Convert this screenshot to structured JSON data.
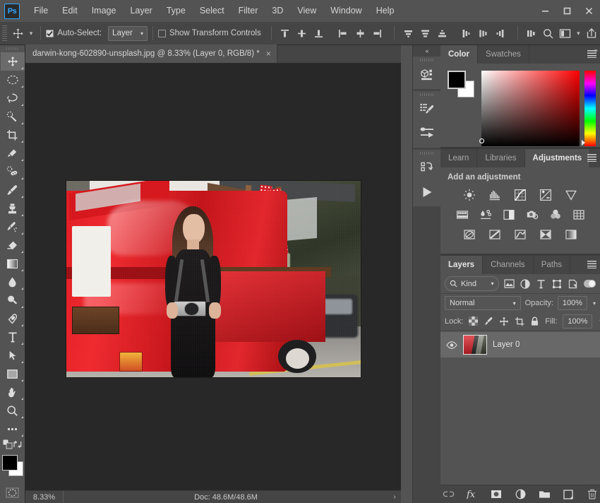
{
  "app": {
    "logo_text": "Ps",
    "menus": [
      "File",
      "Edit",
      "Image",
      "Layer",
      "Type",
      "Select",
      "Filter",
      "3D",
      "View",
      "Window",
      "Help"
    ],
    "window_controls": [
      "minimize-button",
      "maximize-button",
      "close-button"
    ]
  },
  "options_bar": {
    "active_tool_icon": "move-tool-icon",
    "auto_select_label": "Auto-Select:",
    "auto_select_checked": true,
    "auto_select_scope": "Layer",
    "show_transform_label": "Show Transform Controls",
    "show_transform_checked": false,
    "align_icons": [
      "align-top-edges-icon",
      "align-vertical-centers-icon",
      "align-bottom-edges-icon",
      "align-left-edges-icon",
      "align-horizontal-centers-icon",
      "align-right-edges-icon"
    ],
    "distribute_icons": [
      "distribute-top-edges-icon",
      "distribute-vertical-centers-icon",
      "distribute-bottom-edges-icon",
      "distribute-left-edges-icon",
      "distribute-horizontal-centers-icon",
      "distribute-right-edges-icon"
    ],
    "extra_icons": [
      "align-distribute-options-icon",
      "search-icon",
      "workspace-icon",
      "share-icon"
    ]
  },
  "toolbar": {
    "tools": [
      {
        "name": "move-tool",
        "selected": true
      },
      {
        "name": "marquee-tool",
        "selected": false
      },
      {
        "name": "lasso-tool",
        "selected": false
      },
      {
        "name": "quick-selection-tool",
        "selected": false
      },
      {
        "name": "crop-tool",
        "selected": false
      },
      {
        "name": "eyedropper-tool",
        "selected": false
      },
      {
        "name": "healing-brush-tool",
        "selected": false
      },
      {
        "name": "brush-tool",
        "selected": false
      },
      {
        "name": "clone-stamp-tool",
        "selected": false
      },
      {
        "name": "history-brush-tool",
        "selected": false
      },
      {
        "name": "eraser-tool",
        "selected": false
      },
      {
        "name": "gradient-tool",
        "selected": false
      },
      {
        "name": "blur-tool",
        "selected": false
      },
      {
        "name": "dodge-tool",
        "selected": false
      },
      {
        "name": "pen-tool",
        "selected": false
      },
      {
        "name": "type-tool",
        "selected": false
      },
      {
        "name": "path-selection-tool",
        "selected": false
      },
      {
        "name": "rectangle-tool",
        "selected": false
      },
      {
        "name": "hand-tool",
        "selected": false
      },
      {
        "name": "zoom-tool",
        "selected": false
      },
      {
        "name": "edit-toolbar-tool",
        "selected": false
      }
    ],
    "foreground_color": "#000000",
    "background_color": "#ffffff",
    "quick_mask_icon": "quick-mask-icon"
  },
  "document": {
    "tab_title": "darwin-kong-602890-unsplash.jpg @ 8.33% (Layer 0, RGB/8) *",
    "close_glyph": "×",
    "canvas_background": "#282828"
  },
  "status_bar": {
    "zoom": "8.33%",
    "doc_info": "Doc: 48.6M/48.6M",
    "arrow_glyph": "›"
  },
  "icon_dock": {
    "collapse_glyph": "«",
    "items": [
      "3d-properties-icon",
      "brush-settings-icon",
      "brush-presets-icon",
      "history-icon",
      "actions-play-icon"
    ]
  },
  "color_panel": {
    "expand_glyph": "»",
    "tabs": [
      {
        "label": "Color",
        "active": true
      },
      {
        "label": "Swatches",
        "active": false
      }
    ],
    "menu_icon": "panel-menu-icon",
    "foreground_color": "#000000",
    "background_color": "#ffffff"
  },
  "adjustments_panel": {
    "tabs": [
      {
        "label": "Learn",
        "active": false
      },
      {
        "label": "Libraries",
        "active": false
      },
      {
        "label": "Adjustments",
        "active": true
      }
    ],
    "menu_icon": "panel-menu-icon",
    "heading": "Add an adjustment",
    "rows": [
      [
        "brightness-contrast-icon",
        "levels-icon",
        "curves-icon",
        "exposure-icon",
        "vibrance-icon"
      ],
      [
        "hue-saturation-icon",
        "color-balance-icon",
        "black-white-icon",
        "photo-filter-icon",
        "channel-mixer-icon",
        "color-lookup-icon"
      ],
      [
        "invert-icon",
        "posterize-icon",
        "threshold-icon",
        "selective-color-icon",
        "gradient-map-icon"
      ]
    ]
  },
  "layers_panel": {
    "tabs": [
      {
        "label": "Layers",
        "active": true
      },
      {
        "label": "Channels",
        "active": false
      },
      {
        "label": "Paths",
        "active": false
      }
    ],
    "menu_icon": "panel-menu-icon",
    "filter": {
      "kind_label": "Kind",
      "search_icon": "search-icon",
      "caret_glyph": "⌄",
      "filter_icons": [
        "filter-pixel-icon",
        "filter-adjustment-icon",
        "filter-type-icon",
        "filter-shape-icon",
        "filter-smart-object-icon"
      ],
      "toggle_on": true
    },
    "blend_mode": "Normal",
    "opacity_label": "Opacity:",
    "opacity_value": "100%",
    "lock_label": "Lock:",
    "lock_icons": [
      "lock-transparent-pixels-icon",
      "lock-image-pixels-icon",
      "lock-position-icon",
      "lock-artboard-icon",
      "lock-all-icon"
    ],
    "fill_label": "Fill:",
    "fill_value": "100%",
    "layers": [
      {
        "name": "Layer 0",
        "visible": true,
        "selected": true,
        "thumbnail": "photo-thumbnail"
      }
    ],
    "bottom_icons": [
      "link-layers-icon",
      "layer-style-fx-icon",
      "add-layer-mask-icon",
      "new-adjustment-layer-icon",
      "new-group-icon",
      "new-layer-icon",
      "delete-layer-icon"
    ]
  }
}
